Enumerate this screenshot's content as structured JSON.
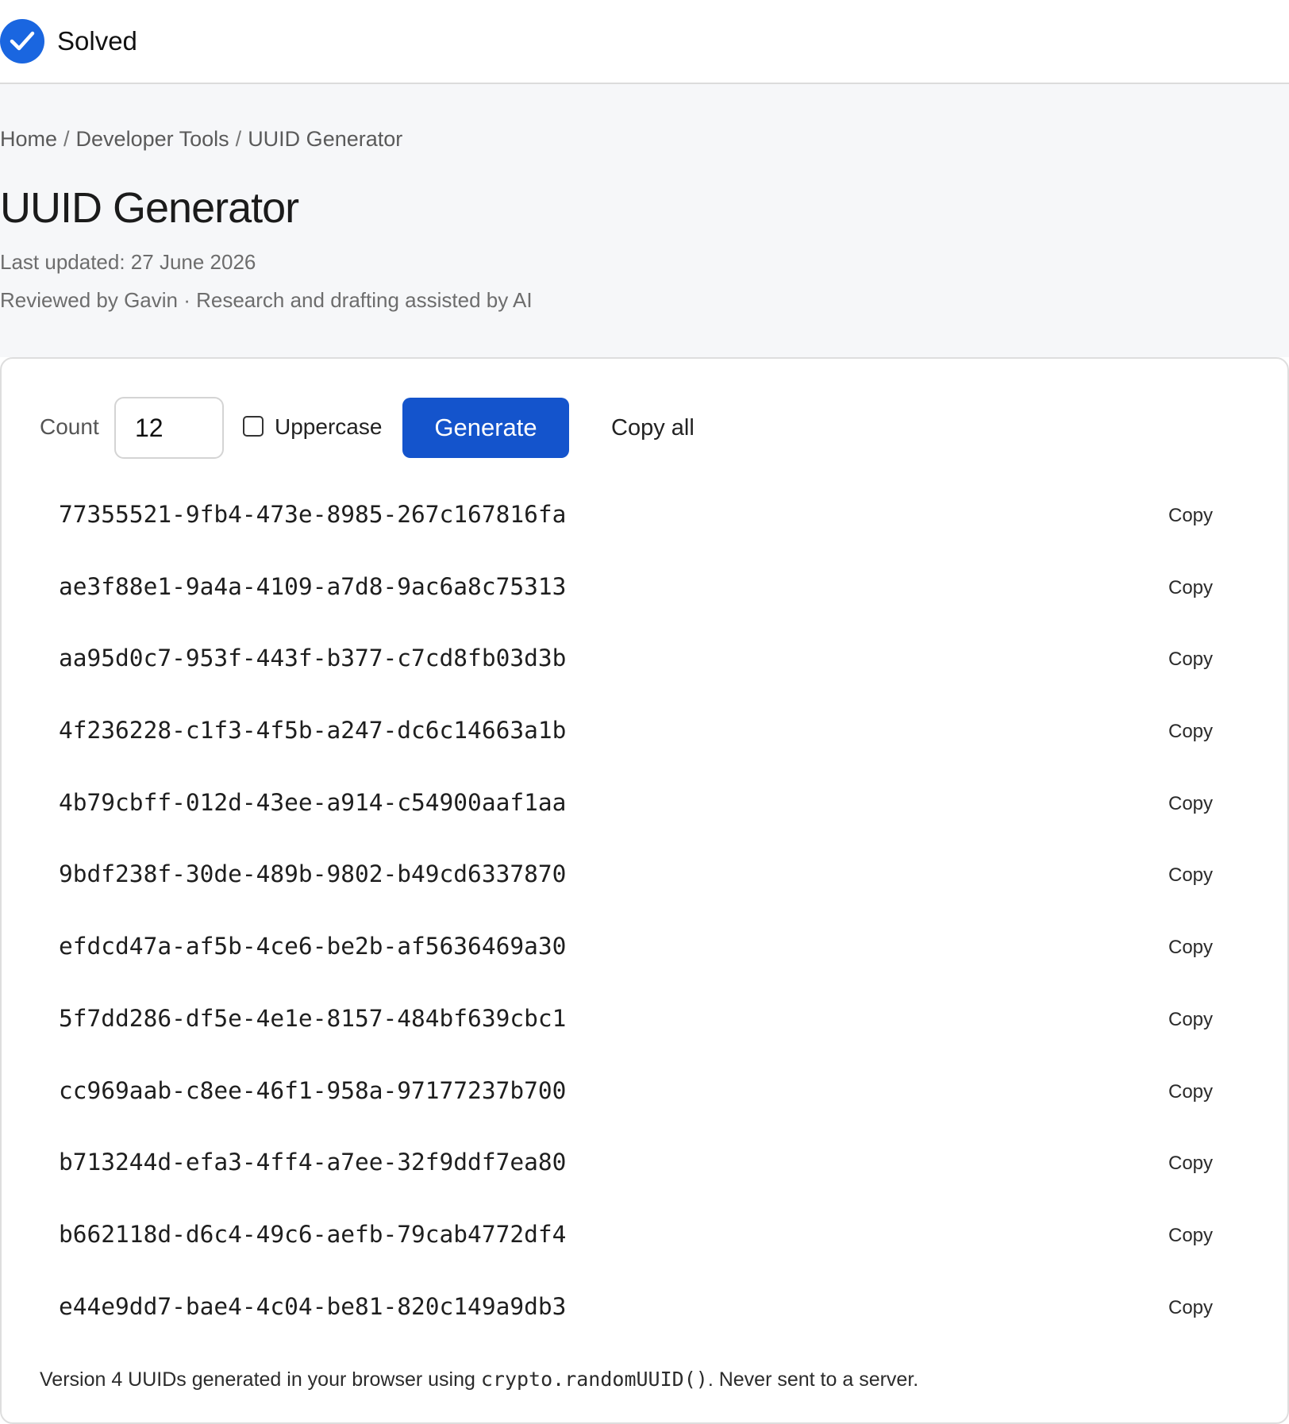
{
  "status": {
    "label": "Solved",
    "icon": "check-circle-icon",
    "color": "#1a66e0"
  },
  "breadcrumb": {
    "items": [
      "Home",
      "Developer Tools",
      "UUID Generator"
    ],
    "separator": "/"
  },
  "page": {
    "title": "UUID Generator",
    "last_updated": "Last updated: 27 June 2026",
    "reviewed": "Reviewed by Gavin · Research and drafting assisted by AI"
  },
  "controls": {
    "count_label": "Count",
    "count_value": "12",
    "uppercase_label": "Uppercase",
    "uppercase_checked": false,
    "generate_label": "Generate",
    "generate_color": "#1454cc",
    "copy_all_label": "Copy all"
  },
  "uuids": [
    {
      "value": "77355521-9fb4-473e-8985-267c167816fa",
      "copy_label": "Copy"
    },
    {
      "value": "ae3f88e1-9a4a-4109-a7d8-9ac6a8c75313",
      "copy_label": "Copy"
    },
    {
      "value": "aa95d0c7-953f-443f-b377-c7cd8fb03d3b",
      "copy_label": "Copy"
    },
    {
      "value": "4f236228-c1f3-4f5b-a247-dc6c14663a1b",
      "copy_label": "Copy"
    },
    {
      "value": "4b79cbff-012d-43ee-a914-c54900aaf1aa",
      "copy_label": "Copy"
    },
    {
      "value": "9bdf238f-30de-489b-9802-b49cd6337870",
      "copy_label": "Copy"
    },
    {
      "value": "efdcd47a-af5b-4ce6-be2b-af5636469a30",
      "copy_label": "Copy"
    },
    {
      "value": "5f7dd286-df5e-4e1e-8157-484bf639cbc1",
      "copy_label": "Copy"
    },
    {
      "value": "cc969aab-c8ee-46f1-958a-97177237b700",
      "copy_label": "Copy"
    },
    {
      "value": "b713244d-efa3-4ff4-a7ee-32f9ddf7ea80",
      "copy_label": "Copy"
    },
    {
      "value": "b662118d-d6c4-49c6-aefb-79cab4772df4",
      "copy_label": "Copy"
    },
    {
      "value": "e44e9dd7-bae4-4c04-be81-820c149a9db3",
      "copy_label": "Copy"
    }
  ],
  "footnote": {
    "before": "Version 4 UUIDs generated in your browser using ",
    "code": "crypto.randomUUID()",
    "after": ". Never sent to a server."
  }
}
